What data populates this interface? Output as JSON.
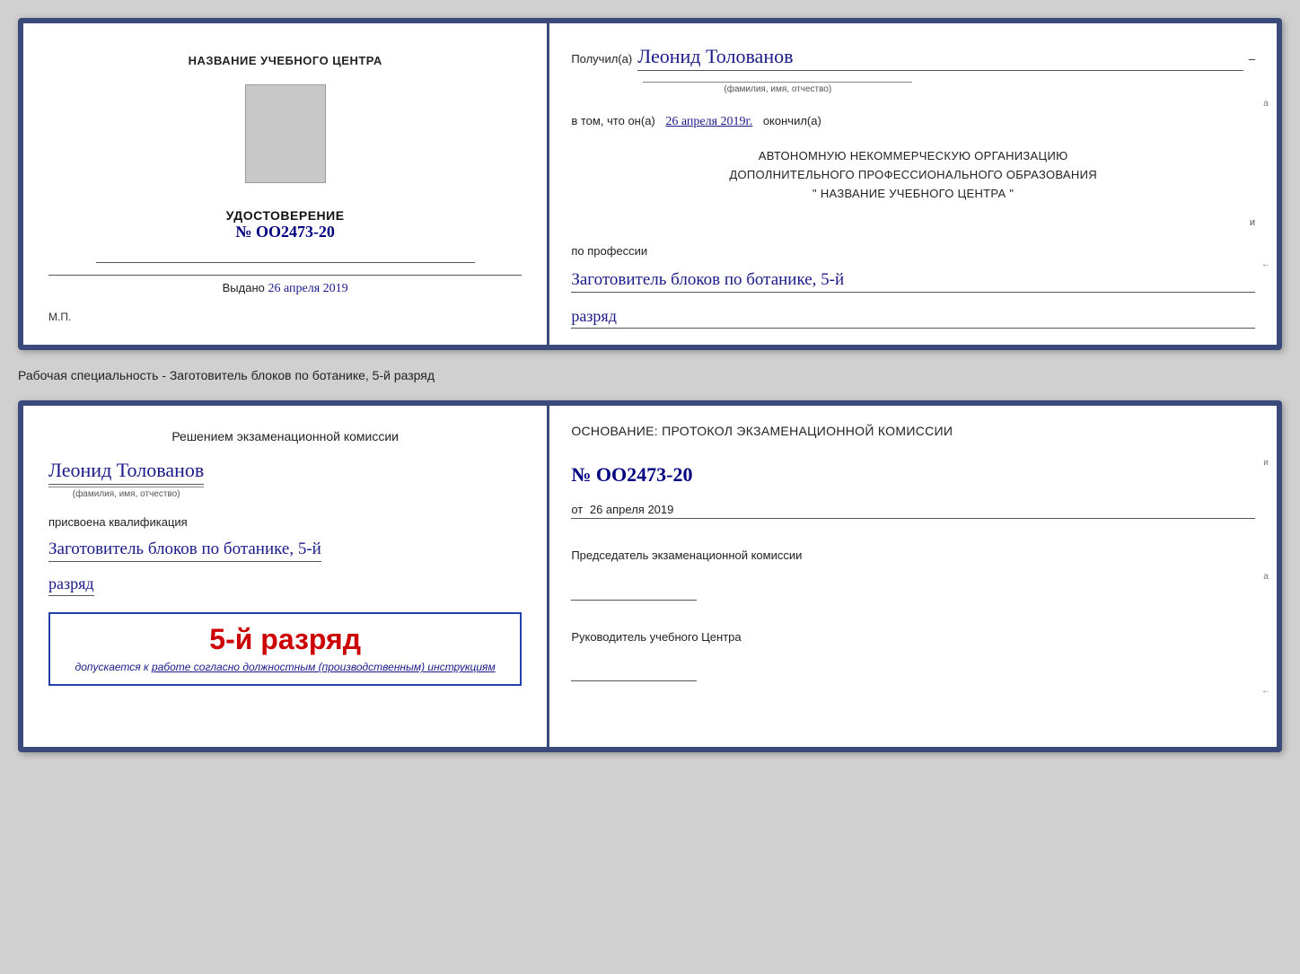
{
  "top_doc": {
    "left": {
      "center_title": "НАЗВАНИЕ УЧЕБНОГО ЦЕНТРА",
      "cert_title": "УДОСТОВЕРЕНИЕ",
      "cert_number_prefix": "№",
      "cert_number": "OO2473-20",
      "issued_label": "Выдано",
      "issued_date": "26 апреля 2019",
      "mp_label": "М.П."
    },
    "right": {
      "received_label": "Получил(а)",
      "recipient_name": "Леонид Толованов",
      "name_caption": "(фамилия, имя, отчество)",
      "confirmed_label": "в том, что он(а)",
      "confirmed_date": "26 апреля 2019г.",
      "finished_label": "окончил(а)",
      "org_line1": "АВТОНОМНУЮ НЕКОММЕРЧЕСКУЮ ОРГАНИЗАЦИЮ",
      "org_line2": "ДОПОЛНИТЕЛЬНОГО ПРОФЕССИОНАЛЬНОГО ОБРАЗОВАНИЯ",
      "org_line3": "\"  НАЗВАНИЕ УЧЕБНОГО ЦЕНТРА  \"",
      "profession_label": "по профессии",
      "profession_name": "Заготовитель блоков по ботанике, 5-й",
      "rank_text": "разряд"
    }
  },
  "separator": {
    "label": "Рабочая специальность - Заготовитель блоков по ботанике, 5-й разряд"
  },
  "bottom_doc": {
    "left": {
      "decision_label": "Решением экзаменационной комиссии",
      "person_name": "Леонид Толованов",
      "name_caption": "(фамилия, имя, отчество)",
      "assigned_label": "присвоена квалификация",
      "qualification": "Заготовитель блоков по ботанике, 5-й",
      "rank_text": "разряд",
      "big_rank": "5-й разряд",
      "allowed_prefix": "допускается к",
      "allowed_text": "работе согласно должностным (производственным) инструкциям"
    },
    "right": {
      "base_label": "Основание: протокол экзаменационной комиссии",
      "protocol_number_prefix": "№",
      "protocol_number": "OO2473-20",
      "from_label": "от",
      "from_date": "26 апреля 2019",
      "chairman_label": "Председатель экзаменационной комиссии",
      "director_label": "Руководитель учебного Центра"
    }
  }
}
